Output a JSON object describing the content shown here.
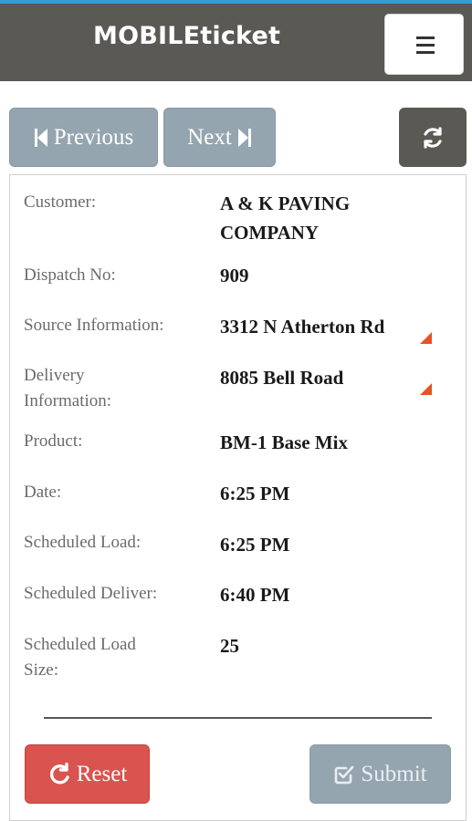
{
  "header": {
    "title": "MOBILEticket"
  },
  "nav": {
    "previous_label": "Previous",
    "next_label": "Next"
  },
  "ticket": {
    "rows": [
      {
        "label": "Customer:",
        "value": "A & K PAVING COMPANY"
      },
      {
        "label": "Dispatch No:",
        "value": "909"
      },
      {
        "label": "Source Information:",
        "value": "3312 N Atherton Rd"
      },
      {
        "label": "Delivery Information:",
        "value": "8085 Bell Road"
      },
      {
        "label": "Product:",
        "value": "BM-1 Base Mix"
      },
      {
        "label": "Date:",
        "value": "6:25 PM"
      },
      {
        "label": "Scheduled Load:",
        "value": "6:25 PM"
      },
      {
        "label": "Scheduled Deliver:",
        "value": "6:40 PM"
      },
      {
        "label": "Scheduled Load Size:",
        "value": "25"
      }
    ]
  },
  "actions": {
    "reset_label": "Reset",
    "submit_label": "Submit"
  },
  "colors": {
    "header_bg": "#5a5954",
    "accent_line": "#2f9fd3",
    "nav_button": "#95a5b0",
    "reset_button": "#d9534f",
    "indicator": "#e8522a"
  },
  "icons": {
    "menu": "hamburger-icon",
    "previous": "step-backward-icon",
    "next": "step-forward-icon",
    "refresh": "refresh-icon",
    "reset": "reset-icon",
    "submit": "check-square-icon"
  }
}
